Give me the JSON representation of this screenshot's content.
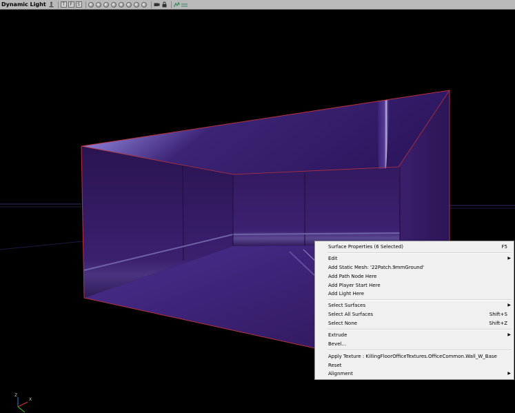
{
  "viewport": {
    "title": "Dynamic Light",
    "toolbar_buttons": [
      "T",
      "F",
      "S"
    ],
    "toolbar_icons": [
      "actor-icon",
      "realtime-preview-icon",
      "wireframe-icon",
      "brush-wireframe-icon",
      "unlit-icon",
      "lit-icon",
      "lighting-only-icon",
      "light-complexity-icon",
      "texture-density-icon",
      "camera-icon",
      "lock-icon",
      "show-flags-icon",
      "game-view-icon"
    ]
  },
  "axis": {
    "z": "Z",
    "x": "X"
  },
  "context_menu": {
    "surface_properties": "Surface Properties (6 Selected)",
    "surface_properties_shortcut": "F5",
    "edit": "Edit",
    "add_static_mesh": "Add Static Mesh: '22Patch.9mmGround'",
    "add_path_node": "Add Path Node Here",
    "add_player_start": "Add Player Start Here",
    "add_light": "Add Light Here",
    "select_surfaces": "Select Surfaces",
    "select_all_surfaces": "Select All Surfaces",
    "select_all_surfaces_shortcut": "Shift+S",
    "select_none": "Select None",
    "select_none_shortcut": "Shift+Z",
    "extrude": "Extrude",
    "bevel": "Bevel...",
    "apply_texture": "Apply Texture : KillingFloorOfficeTextures.OfficeCommon.Wall_W_Base",
    "reset": "Reset",
    "alignment": "Alignment",
    "submenu_arrow": "▶"
  },
  "colors": {
    "background": "#000000",
    "toolbar": "#b9b9b9",
    "wall": "#3a1d6a",
    "ceiling_highlight": "#c9c2ee",
    "selection_edge": "#b8323c",
    "menu_bg": "#f0f0f0"
  }
}
